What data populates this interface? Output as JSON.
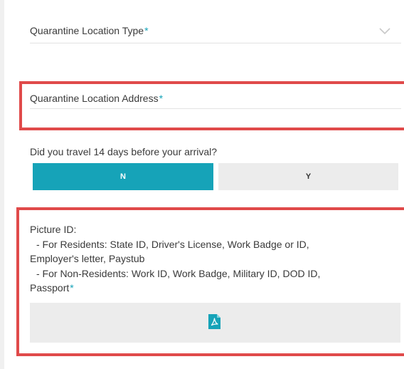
{
  "quarantine_type": {
    "label": "Quarantine Location Type",
    "required_mark": "*",
    "icon": "chevron-down-icon"
  },
  "quarantine_address": {
    "label": "Quarantine Location Address",
    "required_mark": "*",
    "value": ""
  },
  "travel": {
    "question": "Did you travel 14 days before your arrival?",
    "options": [
      "N",
      "Y"
    ],
    "selected": "N"
  },
  "picture_id": {
    "title": "Picture ID:",
    "lines": [
      "- For Residents: State ID, Driver's License, Work Badge or ID,",
      "Employer's letter, Paystub",
      "- For Non-Residents: Work ID, Work Badge, Military ID, DOD ID,",
      "Passport"
    ],
    "required_mark": "*",
    "upload_icon": "pdf-file-icon"
  },
  "colors": {
    "accent": "#16a3b8",
    "highlight": "#e04a4a",
    "toggle_inactive": "#ececec",
    "required": "#16a3b8"
  }
}
